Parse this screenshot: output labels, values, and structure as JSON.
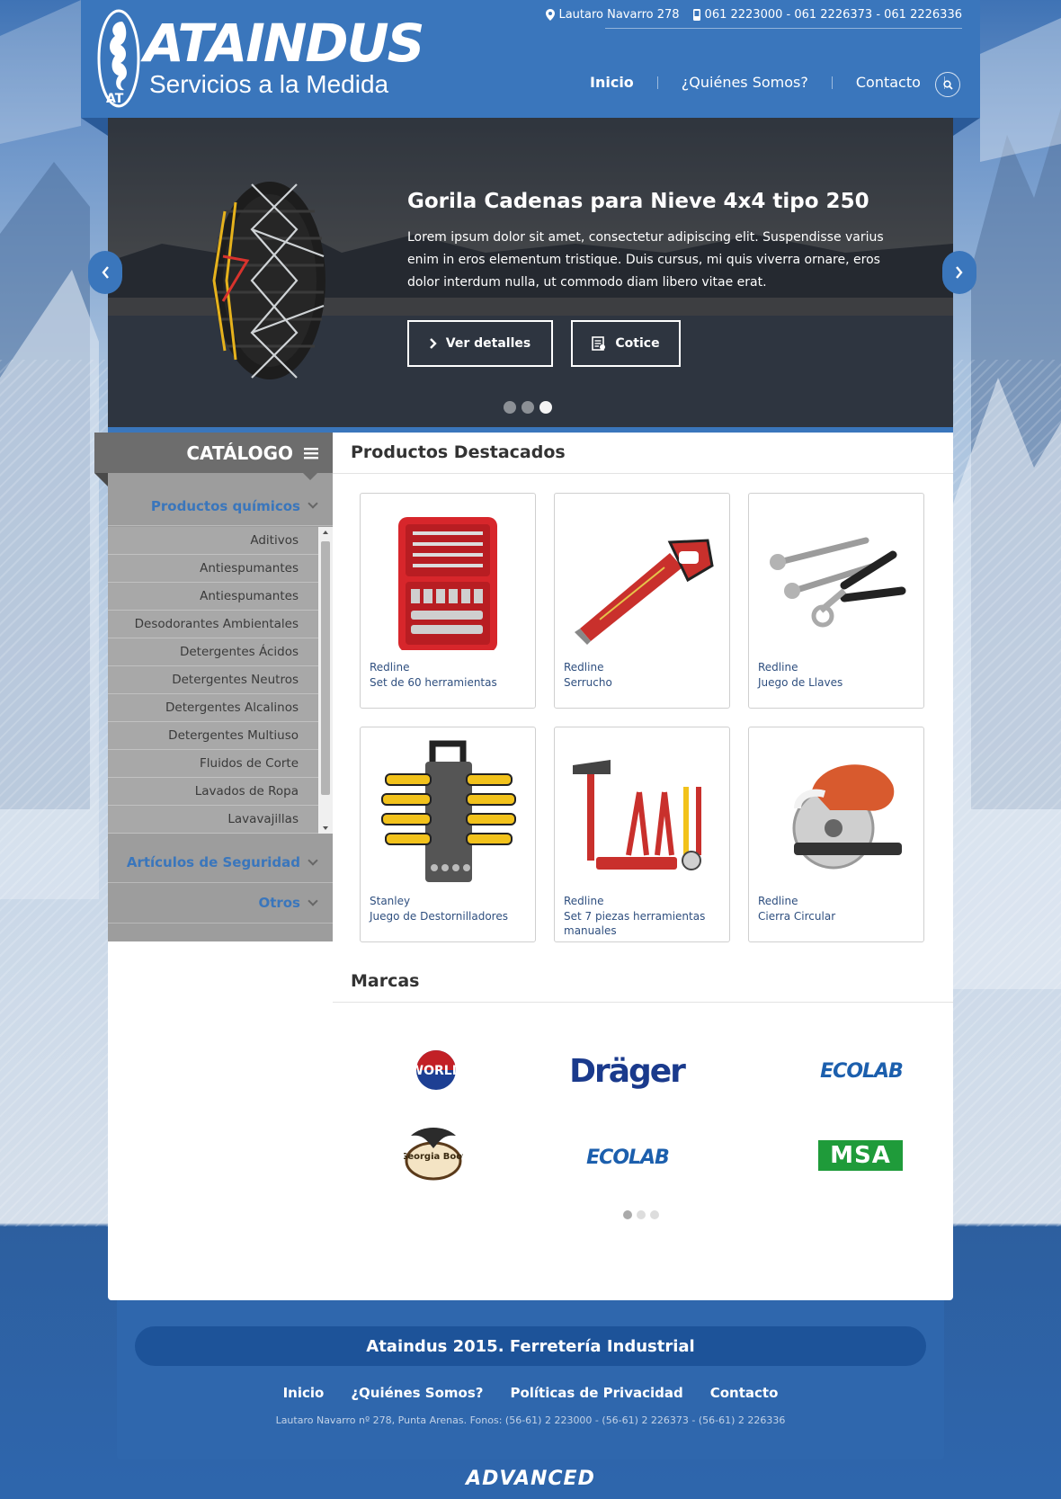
{
  "header": {
    "brand_name": "ATAINDUS",
    "tagline": "Servicios a la Medida",
    "address": "Lautaro Navarro 278",
    "phones": "061 2223000 - 061 2226373 - 061 2226336",
    "nav": [
      {
        "label": "Inicio"
      },
      {
        "label": "¿Quiénes Somos?"
      },
      {
        "label": "Contacto"
      }
    ]
  },
  "slider": {
    "title": "Gorila Cadenas para Nieve 4x4 tipo 250",
    "text": "Lorem ipsum dolor sit amet, consectetur adipiscing elit. Suspendisse varius enim in eros elementum tristique. Duis cursus, mi quis viverra ornare, eros dolor interdum nulla, ut commodo diam libero vitae erat.",
    "details_label": "Ver detalles",
    "quote_label": "Cotice",
    "active_slide": 3,
    "slide_count": 3
  },
  "catalog": {
    "title": "CATÁLOGO",
    "sections": [
      {
        "label": "Productos químicos"
      },
      {
        "label": "Artículos de Seguridad"
      },
      {
        "label": "Otros"
      }
    ],
    "items": [
      "Aditivos",
      "Antiespumantes",
      "Antiespumantes",
      "Desodorantes Ambientales",
      "Detergentes Ácidos",
      "Detergentes Neutros",
      "Detergentes Alcalinos",
      "Detergentes Multiuso",
      "Fluidos de Corte",
      "Lavados de Ropa",
      "Lavavajillas"
    ]
  },
  "featured": {
    "title": "Productos Destacados",
    "products": [
      {
        "brand": "Redline",
        "name": "Set de 60 herramientas",
        "icon": "toolbox-icon"
      },
      {
        "brand": "Redline",
        "name": "Serrucho",
        "icon": "handsaw-icon"
      },
      {
        "brand": "Redline",
        "name": "Juego de Llaves",
        "icon": "wrench-set-icon"
      },
      {
        "brand": "Stanley",
        "name": "Juego de Destornilladores",
        "icon": "screwdriver-set-icon"
      },
      {
        "brand": "Redline",
        "name": "Set 7 piezas herramientas manuales",
        "icon": "hand-tools-icon"
      },
      {
        "brand": "Redline",
        "name": "Cierra Circular",
        "icon": "circular-saw-icon"
      }
    ]
  },
  "brands": {
    "title": "Marcas",
    "logos": [
      {
        "name": "WORLD",
        "color": "#c22026"
      },
      {
        "name": "Dräger",
        "color": "#1a3a8c"
      },
      {
        "name": "ECOLAB",
        "color": "#1c5fad"
      },
      {
        "name": "Georgia Boot",
        "color": "#5a3a1a"
      },
      {
        "name": "ECOLAB",
        "color": "#1c5fad"
      },
      {
        "name": "MSA",
        "color": "#1f9b3a"
      }
    ],
    "active_page": 1,
    "page_count": 3
  },
  "footer": {
    "title": "Ataindus 2015. Ferretería Industrial",
    "nav": [
      "Inicio",
      "¿Quiénes Somos?",
      "Políticas de Privacidad",
      "Contacto"
    ],
    "address": "Lautaro Navarro nº 278, Punta Arenas. Fonos: (56-61) 2 223000 - (56-61) 2 226373 - (56-61) 2 226336",
    "credit": "ADVANCED"
  },
  "colors": {
    "primary": "#3a76bc",
    "sidebar": "#9d9d9d",
    "catalog_header": "#6d6d6d",
    "link": "#2f4f7f"
  }
}
